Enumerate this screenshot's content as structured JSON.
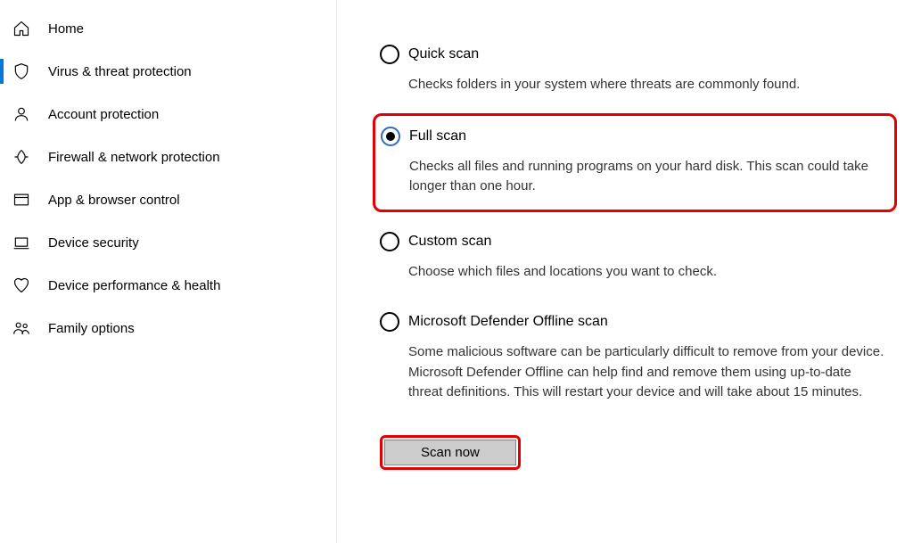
{
  "sidebar": {
    "items": [
      {
        "label": "Home",
        "active": false
      },
      {
        "label": "Virus & threat protection",
        "active": true
      },
      {
        "label": "Account protection",
        "active": false
      },
      {
        "label": "Firewall & network protection",
        "active": false
      },
      {
        "label": "App & browser control",
        "active": false
      },
      {
        "label": "Device security",
        "active": false
      },
      {
        "label": "Device performance & health",
        "active": false
      },
      {
        "label": "Family options",
        "active": false
      }
    ]
  },
  "scan_options": [
    {
      "id": "quick",
      "title": "Quick scan",
      "desc": "Checks folders in your system where threats are commonly found.",
      "selected": false,
      "highlight": false
    },
    {
      "id": "full",
      "title": "Full scan",
      "desc": "Checks all files and running programs on your hard disk. This scan could take longer than one hour.",
      "selected": true,
      "highlight": true
    },
    {
      "id": "custom",
      "title": "Custom scan",
      "desc": "Choose which files and locations you want to check.",
      "selected": false,
      "highlight": false
    },
    {
      "id": "offline",
      "title": "Microsoft Defender Offline scan",
      "desc": "Some malicious software can be particularly difficult to remove from your device. Microsoft Defender Offline can help find and remove them using up-to-date threat definitions. This will restart your device and will take about 15 minutes.",
      "selected": false,
      "highlight": false
    }
  ],
  "scan_button": "Scan now"
}
